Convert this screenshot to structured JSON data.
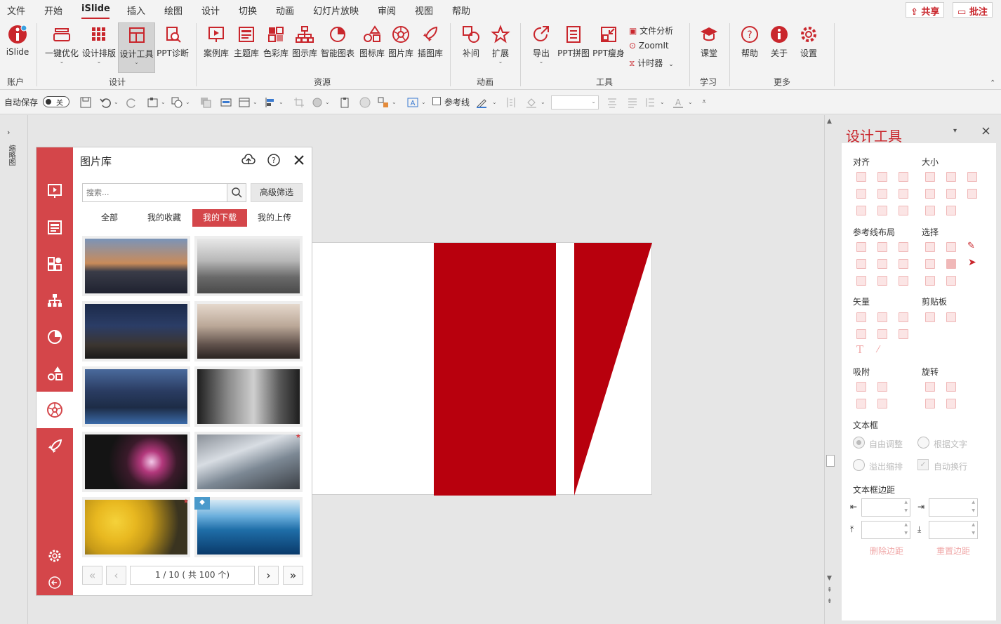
{
  "menubar": {
    "items": [
      "文件",
      "开始",
      "iSlide",
      "插入",
      "绘图",
      "设计",
      "切换",
      "动画",
      "幻灯片放映",
      "审阅",
      "视图",
      "帮助"
    ],
    "share": "共享",
    "comment": "批注"
  },
  "ribbon": {
    "account": {
      "label": "iSlide",
      "group": "账户"
    },
    "design": {
      "buttons": [
        "一键优化",
        "设计排版",
        "设计工具",
        "PPT诊断"
      ],
      "group": "设计"
    },
    "resources": {
      "buttons": [
        "案例库",
        "主题库",
        "色彩库",
        "图示库",
        "智能图表",
        "图标库",
        "图片库",
        "插图库"
      ],
      "group": "资源"
    },
    "animation": {
      "buttons": [
        "补间",
        "扩展"
      ],
      "group": "动画"
    },
    "tools": {
      "buttons": [
        "导出",
        "PPT拼图",
        "PPT瘦身"
      ],
      "small": [
        "文件分析",
        "ZoomIt",
        "计时器"
      ],
      "group": "工具"
    },
    "learn": {
      "buttons": [
        "课堂"
      ],
      "group": "学习"
    },
    "more": {
      "buttons": [
        "帮助",
        "关于",
        "设置"
      ],
      "group": "更多"
    }
  },
  "toolbar2": {
    "autosave": "自动保存",
    "autosave_state": "关",
    "guides": "参考线"
  },
  "left_strip": {
    "label": "缩略图"
  },
  "library": {
    "title": "图片库",
    "search_placeholder": "搜索...",
    "filter": "高级筛选",
    "tabs": [
      "全部",
      "我的收藏",
      "我的下载",
      "我的上传"
    ],
    "active_tab": "我的下载",
    "pager": "1 / 10 ( 共 100 个)"
  },
  "design_panel": {
    "title": "设计工具",
    "sections": {
      "align": "对齐",
      "size": "大小",
      "guides_layout": "参考线布局",
      "select": "选择",
      "vector": "矢量",
      "clipboard": "剪贴板",
      "snap": "吸附",
      "rotate": "旋转",
      "textbox": "文本框",
      "textbox_margin": "文本框边距"
    },
    "textbox_options": {
      "free": "自由调整",
      "fit": "根据文字",
      "overflow": "溢出缩排",
      "wrap": "自动换行"
    },
    "margin_buttons": {
      "delete": "删除边距",
      "reset": "重置边距"
    }
  },
  "colors": {
    "accent": "#c9262c",
    "sidebar": "#d4464a",
    "slide_red": "#b8000d"
  }
}
